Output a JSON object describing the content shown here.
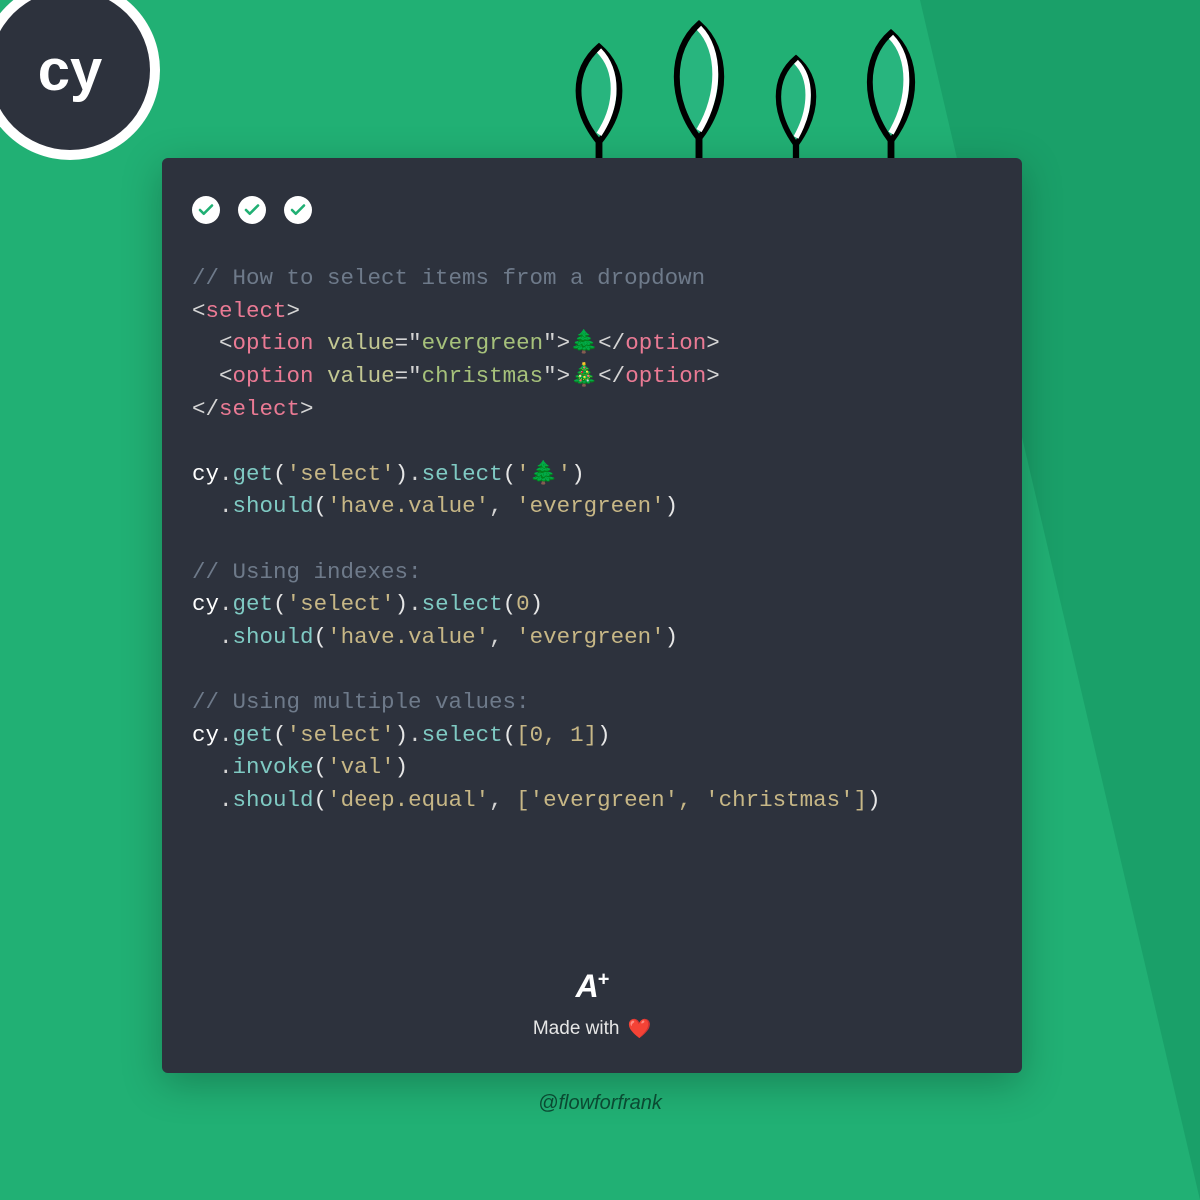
{
  "logo": {
    "label": "cy"
  },
  "decor": {
    "tree_count": 4
  },
  "card": {
    "passes": 3,
    "code": {
      "comment1": "// How to select items from a dropdown",
      "select_open": "select",
      "option_tag": "option",
      "attr_value": "value",
      "opt1_value": "evergreen",
      "opt1_emoji": "🌲",
      "opt2_value": "christmas",
      "opt2_emoji": "🎄",
      "cy": "cy",
      "get": "get",
      "select_m": "select",
      "should": "should",
      "invoke": "invoke",
      "arg_select": "'select'",
      "arg_tree": "'🌲'",
      "have_value": "'have.value'",
      "evergreen_s": "'evergreen'",
      "comment2": "// Using indexes:",
      "zero": "0",
      "comment3": "// Using multiple values:",
      "zero_one": "[0, 1]",
      "val": "'val'",
      "deep_equal": "'deep.equal'",
      "arr_ev_ch": "['evergreen', 'christmas']"
    },
    "footer": {
      "logo_a": "A",
      "logo_plus": "+",
      "made_with": "Made with",
      "heart": "❤️"
    }
  },
  "handle": "@flowforfrank"
}
